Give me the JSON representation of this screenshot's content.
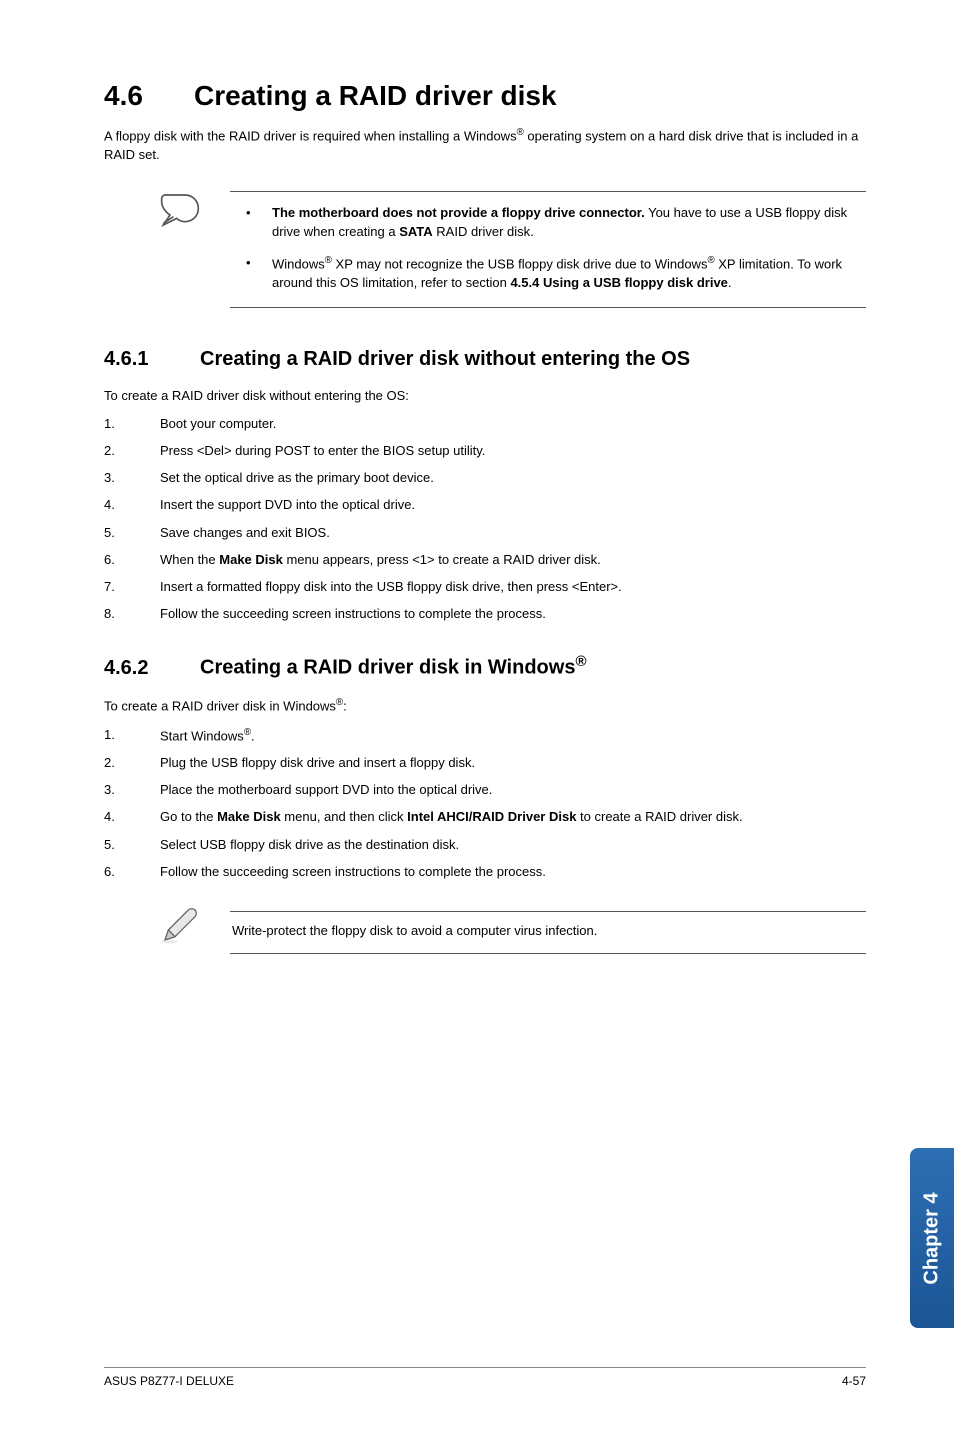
{
  "heading1": {
    "num": "4.6",
    "title": "Creating a RAID driver disk"
  },
  "intro_parts": {
    "p1": "A floppy disk with the RAID driver is required when installing a Windows",
    "sup1": "®",
    "p2": " operating system on a hard disk drive that is included in a RAID set."
  },
  "note_items": [
    {
      "parts": [
        {
          "t": "The motherboard does not provide a floppy drive connector.",
          "b": true
        },
        {
          "t": " You have to use a USB floppy disk drive when creating a "
        },
        {
          "t": "SATA",
          "b": true
        },
        {
          "t": " RAID driver disk."
        }
      ]
    },
    {
      "parts": [
        {
          "t": "Windows"
        },
        {
          "t": "®",
          "sup": true
        },
        {
          "t": " XP may not recognize the USB floppy disk drive due to Windows"
        },
        {
          "t": "®",
          "sup": true
        },
        {
          "t": " XP limitation. To work around this OS limitation, refer to section "
        },
        {
          "t": "4.5.4 Using a USB floppy disk drive",
          "b": true
        },
        {
          "t": "."
        }
      ]
    }
  ],
  "section1": {
    "num": "4.6.1",
    "title": "Creating a RAID driver disk without entering the OS",
    "lead": "To create a RAID driver disk without entering the OS:",
    "steps": [
      [
        {
          "t": "Boot your computer."
        }
      ],
      [
        {
          "t": "Press <Del> during POST to enter the BIOS setup utility."
        }
      ],
      [
        {
          "t": "Set the optical drive as the primary boot device."
        }
      ],
      [
        {
          "t": "Insert the support DVD into the optical drive."
        }
      ],
      [
        {
          "t": "Save changes and exit BIOS."
        }
      ],
      [
        {
          "t": "When the "
        },
        {
          "t": "Make Disk",
          "b": true
        },
        {
          "t": " menu appears, press <1> to create a RAID driver disk."
        }
      ],
      [
        {
          "t": "Insert a formatted floppy disk into the USB floppy disk drive, then press <Enter>."
        }
      ],
      [
        {
          "t": "Follow the succeeding screen instructions to complete the process."
        }
      ]
    ]
  },
  "section2": {
    "num": "4.6.2",
    "title_parts": {
      "pre": "Creating a RAID driver disk in Windows",
      "sup": "®"
    },
    "lead_parts": {
      "pre": "To create a RAID driver disk in Windows",
      "sup": "®",
      "post": ":"
    },
    "steps": [
      [
        {
          "t": "Start Windows"
        },
        {
          "t": "®",
          "sup": true
        },
        {
          "t": "."
        }
      ],
      [
        {
          "t": "Plug the USB floppy disk drive and insert a floppy disk."
        }
      ],
      [
        {
          "t": "Place the motherboard support DVD into the optical drive."
        }
      ],
      [
        {
          "t": "Go to the "
        },
        {
          "t": "Make Disk",
          "b": true
        },
        {
          "t": " menu, and then click "
        },
        {
          "t": "Intel AHCI/RAID Driver Disk",
          "b": true
        },
        {
          "t": " to create a RAID driver disk."
        }
      ],
      [
        {
          "t": "Select USB floppy disk drive as the destination disk."
        }
      ],
      [
        {
          "t": "Follow the succeeding screen instructions to complete the process."
        }
      ]
    ]
  },
  "tip": "Write-protect the floppy disk to avoid a computer virus infection.",
  "side_tab": "Chapter 4",
  "footer": {
    "left": "ASUS P8Z77-I DELUXE",
    "right": "4-57"
  }
}
